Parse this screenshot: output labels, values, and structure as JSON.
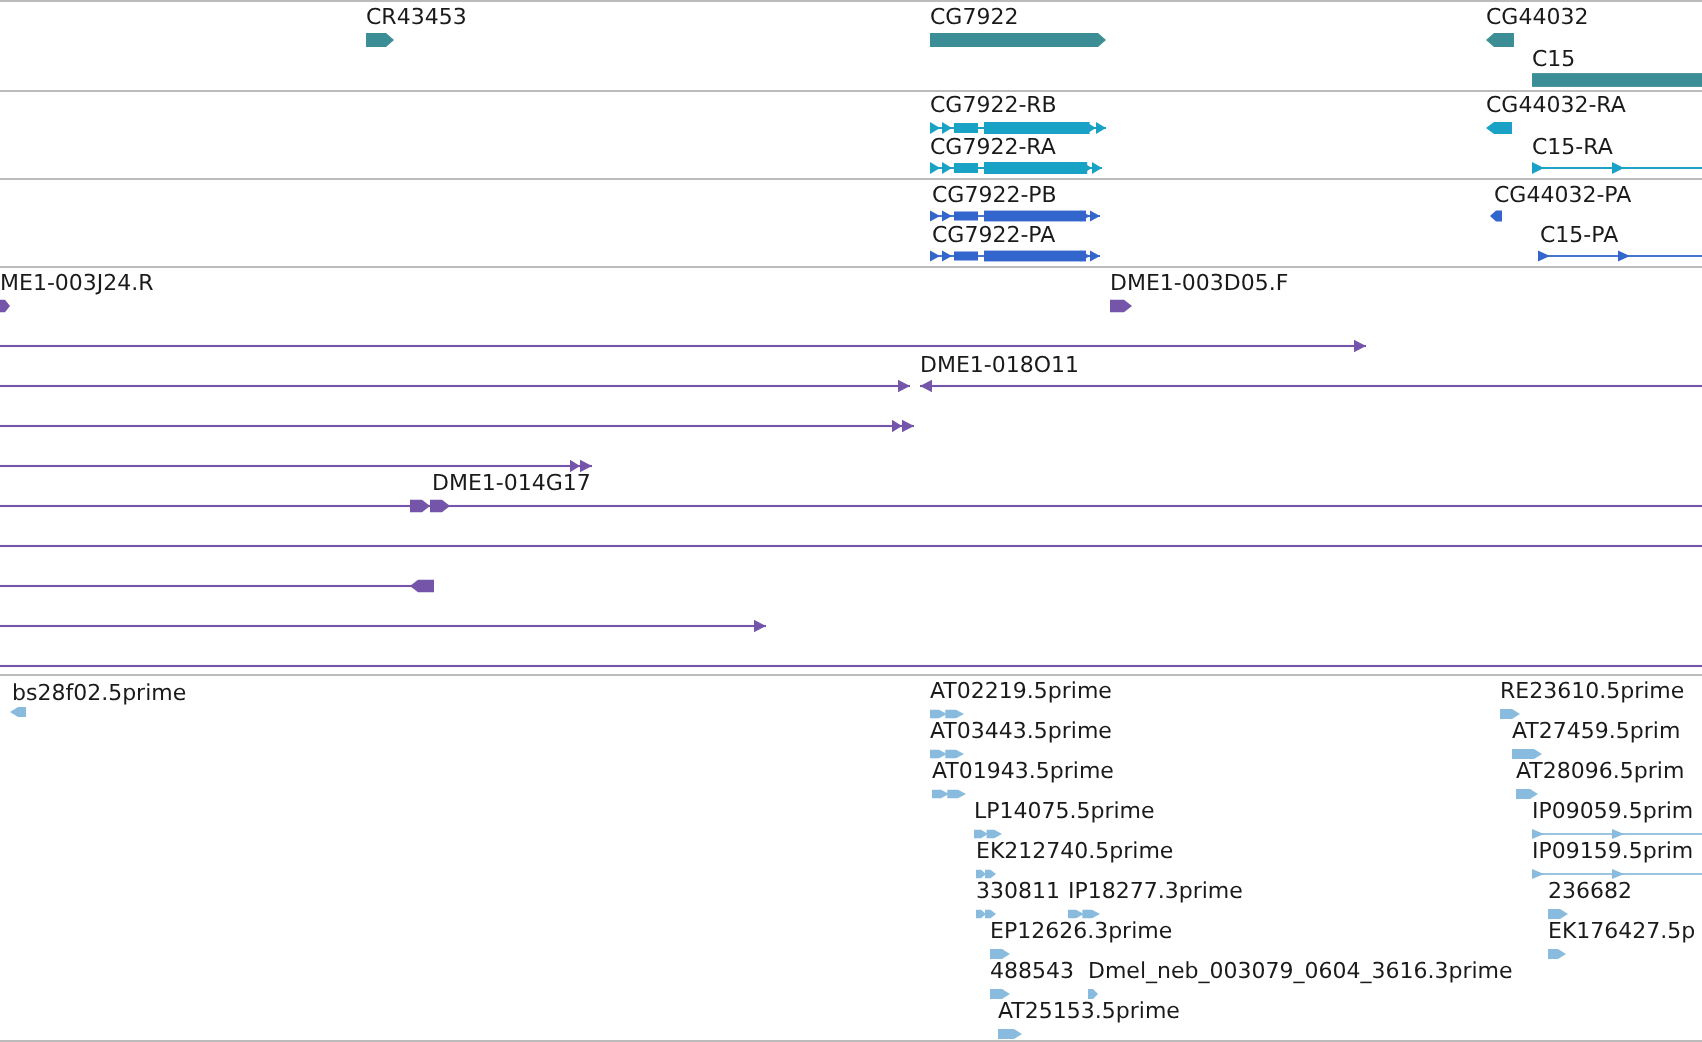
{
  "tracks": [
    {
      "kind": "gene",
      "color": "#3b8e96",
      "features": [
        {
          "label": "CR43453",
          "kind": "arrow",
          "reverse": false
        },
        {
          "label": "CG7922",
          "kind": "arrow",
          "reverse": false
        },
        {
          "label": "CG44032",
          "kind": "arrow",
          "reverse": true
        },
        {
          "label": "C15",
          "kind": "bar"
        }
      ]
    },
    {
      "kind": "transcript",
      "color": "#1aa2c6",
      "features": [
        {
          "label": "CG7922-RB",
          "kind": "exons",
          "reverse": false
        },
        {
          "label": "CG7922-RA",
          "kind": "exons",
          "reverse": false
        },
        {
          "label": "CG44032-RA",
          "kind": "arrow",
          "reverse": true
        },
        {
          "label": "C15-RA",
          "kind": "thin",
          "reverse": false
        }
      ]
    },
    {
      "kind": "protein",
      "color": "#3366cc",
      "features": [
        {
          "label": "CG7922-PB",
          "kind": "exons",
          "reverse": false
        },
        {
          "label": "CG7922-PA",
          "kind": "exons",
          "reverse": false
        },
        {
          "label": "CG44032-PA",
          "kind": "arrow",
          "reverse": true
        },
        {
          "label": "C15-PA",
          "kind": "thin",
          "reverse": false
        }
      ]
    },
    {
      "kind": "clone",
      "color": "#7455aa",
      "features": [
        {
          "label": "ME1-003J24.R",
          "kind": "arrow",
          "reverse": false
        },
        {
          "label": "DME1-003D05.F",
          "kind": "arrow",
          "reverse": false
        },
        {
          "kind": "line",
          "reverse": false
        },
        {
          "kind": "line",
          "reverse": false
        },
        {
          "label": "DME1-018O11",
          "kind": "line",
          "reverse": true
        },
        {
          "kind": "line2",
          "reverse": false
        },
        {
          "kind": "line2",
          "reverse": false
        },
        {
          "label": "DME1-014G17",
          "kind": "mid",
          "reverse": false
        },
        {
          "kind": "plain"
        },
        {
          "kind": "blockend",
          "reverse": true
        },
        {
          "kind": "line",
          "reverse": false
        },
        {
          "kind": "plain"
        }
      ]
    },
    {
      "kind": "est",
      "color": "#88bbdd",
      "features": [
        {
          "label": "bs28f02.5prime",
          "kind": "arrow",
          "reverse": true
        },
        {
          "label": "AT02219.5prime",
          "kind": "arrow2",
          "reverse": false
        },
        {
          "label": "AT03443.5prime",
          "kind": "arrow2",
          "reverse": false
        },
        {
          "label": "AT01943.5prime",
          "kind": "arrow2",
          "reverse": false
        },
        {
          "label": "LP14075.5prime",
          "kind": "arrow2",
          "reverse": false
        },
        {
          "label": "EK212740.5prime",
          "kind": "arrow2",
          "reverse": false
        },
        {
          "label": "330811",
          "kind": "arrow2",
          "reverse": false
        },
        {
          "label": "IP18277.3prime",
          "kind": "arrow2",
          "reverse": false
        },
        {
          "label": "EP12626.3prime",
          "kind": "arrow",
          "reverse": false
        },
        {
          "label": "488543",
          "kind": "arrow",
          "reverse": false
        },
        {
          "label": "Dmel_neb_003079_0604_3616.3prime",
          "kind": "arrow",
          "reverse": false
        },
        {
          "label": "AT25153.5prime",
          "kind": "arrow",
          "reverse": false
        },
        {
          "label": "RE23610.5prime",
          "kind": "arrow",
          "reverse": false
        },
        {
          "label": "AT27459.5prim",
          "kind": "arrow",
          "reverse": false
        },
        {
          "label": "AT28096.5prim",
          "kind": "arrow",
          "reverse": false
        },
        {
          "label": "IP09059.5prim",
          "kind": "thin",
          "reverse": false
        },
        {
          "label": "IP09159.5prim",
          "kind": "thin",
          "reverse": false
        },
        {
          "label": "236682",
          "kind": "arrow",
          "reverse": false
        },
        {
          "label": "EK176427.5p",
          "kind": "arrow",
          "reverse": false
        }
      ]
    }
  ]
}
